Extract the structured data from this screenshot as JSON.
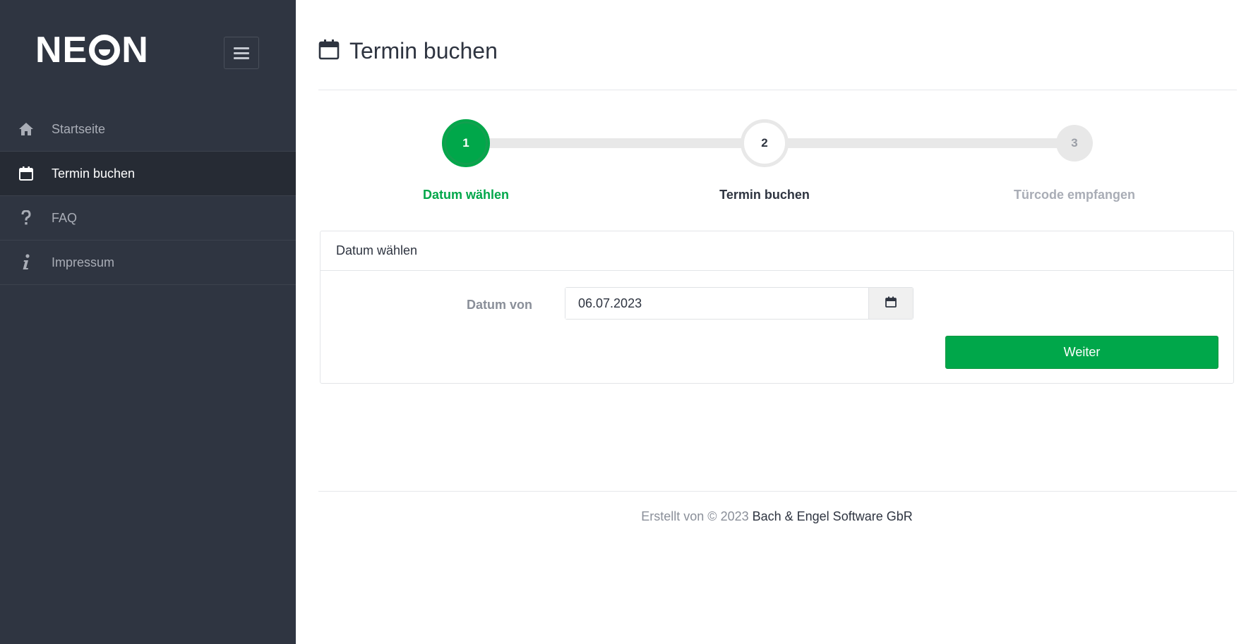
{
  "brand": {
    "logo_text_left": "NE",
    "logo_text_right": "N",
    "logo_name": "NEON"
  },
  "sidebar": {
    "items": [
      {
        "label": "Startseite",
        "icon": "home-icon",
        "active": false
      },
      {
        "label": "Termin buchen",
        "icon": "calendar-icon",
        "active": true
      },
      {
        "label": "FAQ",
        "icon": "question-icon",
        "active": false
      },
      {
        "label": "Impressum",
        "icon": "info-icon",
        "active": false
      }
    ]
  },
  "header": {
    "title": "Termin buchen",
    "icon": "calendar-icon"
  },
  "stepper": {
    "steps": [
      {
        "number": "1",
        "label": "Datum wählen",
        "state": "current"
      },
      {
        "number": "2",
        "label": "Termin buchen",
        "state": "next"
      },
      {
        "number": "3",
        "label": "Türcode empfangen",
        "state": "upcoming"
      }
    ]
  },
  "card": {
    "title": "Datum wählen",
    "date_label": "Datum von",
    "date_value": "06.07.2023",
    "submit_label": "Weiter"
  },
  "footer": {
    "prefix": "Erstellt von © 2023 ",
    "company": "Bach & Engel Software GbR"
  },
  "colors": {
    "sidebar_bg": "#2f3541",
    "accent_green": "#00a74a",
    "text_dark": "#2e3440",
    "muted": "#8a8f99"
  }
}
